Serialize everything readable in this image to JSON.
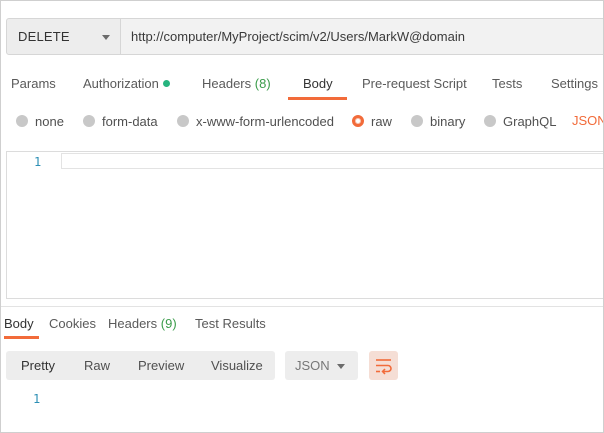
{
  "request": {
    "method": "DELETE",
    "url": "http://computer/MyProject/scim/v2/Users/MarkW@domain"
  },
  "request_tabs": {
    "params": "Params",
    "authorization": "Authorization",
    "headers": "Headers",
    "headers_count": "(8)",
    "body": "Body",
    "prerequest": "Pre-request Script",
    "tests": "Tests",
    "settings": "Settings",
    "active": "Body"
  },
  "body_types": {
    "none": "none",
    "form_data": "form-data",
    "urlencoded": "x-www-form-urlencoded",
    "raw": "raw",
    "binary": "binary",
    "graphql": "GraphQL",
    "selected": "raw",
    "raw_language": "JSON"
  },
  "editor": {
    "line_number": "1",
    "content": ""
  },
  "response_tabs": {
    "body": "Body",
    "cookies": "Cookies",
    "headers": "Headers",
    "headers_count": "(9)",
    "test_results": "Test Results",
    "active": "Body"
  },
  "response_toolbar": {
    "pretty": "Pretty",
    "raw": "Raw",
    "preview": "Preview",
    "visualize": "Visualize",
    "format": "JSON",
    "wrap_icon": "wrap-lines-icon"
  },
  "response_view": {
    "line_number": "1"
  },
  "colors": {
    "accent": "#f26b3a",
    "count_green": "#3b9c4b",
    "auth_dot": "#26b47f",
    "line_number": "#2d8fb5"
  }
}
